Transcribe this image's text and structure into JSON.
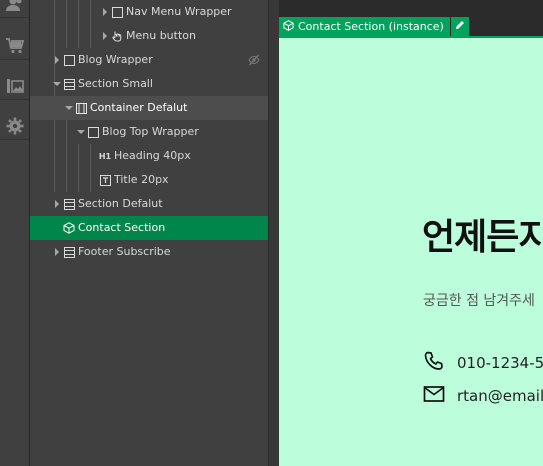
{
  "rail": {
    "icons": [
      "users-icon",
      "cart-icon",
      "media-icon",
      "settings-icon"
    ]
  },
  "navigator": {
    "items": [
      {
        "label": "Nav Menu Wrapper",
        "icon": "box-icon"
      },
      {
        "label": "Menu button",
        "icon": "hand-pointer-icon"
      },
      {
        "label": "Blog Wrapper",
        "icon": "box-icon",
        "hidden_indicator": "eye-slash-icon"
      },
      {
        "label": "Section Small",
        "icon": "section-icon"
      },
      {
        "label": "Container Defalut",
        "icon": "container-icon"
      },
      {
        "label": "Blog Top Wrapper",
        "icon": "box-icon"
      },
      {
        "label": "Heading 40px",
        "icon": "heading-icon",
        "icon_text": "H1"
      },
      {
        "label": "Title 20px",
        "icon": "text-block-icon"
      },
      {
        "label": "Section Defalut",
        "icon": "section-icon"
      },
      {
        "label": "Contact Section",
        "icon": "component-icon"
      },
      {
        "label": "Footer Subscribe",
        "icon": "section-icon"
      }
    ]
  },
  "canvas": {
    "selection_tag": "Contact Section (instance)",
    "heading": "언제든지",
    "subtext": "궁금한 점 남겨주세",
    "phone": "010-1234-5",
    "email": "rtan@email."
  },
  "colors": {
    "selected_row": "#00854a",
    "accent": "#00a35c",
    "section_bg": "#bcfddc",
    "panel_bg": "#404040"
  }
}
